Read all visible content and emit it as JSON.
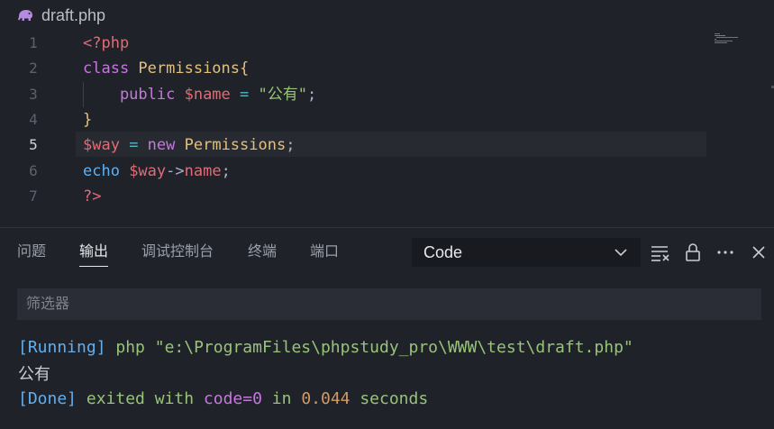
{
  "tab": {
    "file_icon": "php-elephant-icon",
    "file_name": "draft.php"
  },
  "editor": {
    "active_line": 5,
    "lines": [
      {
        "number": "1",
        "tokens": [
          {
            "t": "<?php",
            "c": "tag"
          }
        ]
      },
      {
        "number": "2",
        "tokens": [
          {
            "t": "class ",
            "c": "kw"
          },
          {
            "t": "Permissions{",
            "c": "cls"
          }
        ]
      },
      {
        "number": "3",
        "tokens": [
          {
            "t": "    public ",
            "c": "kw"
          },
          {
            "t": "$name",
            "c": "var"
          },
          {
            "t": " = ",
            "c": "op"
          },
          {
            "t": "\"公有\"",
            "c": "str"
          },
          {
            "t": ";",
            "c": "punc"
          }
        ]
      },
      {
        "number": "4",
        "tokens": [
          {
            "t": "}",
            "c": "cls"
          }
        ]
      },
      {
        "number": "5",
        "tokens": [
          {
            "t": "$way",
            "c": "var"
          },
          {
            "t": " = ",
            "c": "op"
          },
          {
            "t": "new ",
            "c": "kw"
          },
          {
            "t": "Permissions",
            "c": "cls"
          },
          {
            "t": ";",
            "c": "punc"
          }
        ]
      },
      {
        "number": "6",
        "tokens": [
          {
            "t": "echo ",
            "c": "echo"
          },
          {
            "t": "$way",
            "c": "var"
          },
          {
            "t": "->",
            "c": "punc"
          },
          {
            "t": "name",
            "c": "var"
          },
          {
            "t": ";",
            "c": "punc"
          }
        ]
      },
      {
        "number": "7",
        "tokens": [
          {
            "t": "?>",
            "c": "tag"
          }
        ]
      }
    ]
  },
  "panel": {
    "tabs": [
      {
        "label": "问题",
        "active": false
      },
      {
        "label": "输出",
        "active": true
      },
      {
        "label": "调试控制台",
        "active": false
      },
      {
        "label": "终端",
        "active": false
      },
      {
        "label": "端口",
        "active": false
      }
    ],
    "channel_selected": "Code",
    "actions": [
      "clear-output-icon",
      "lock-icon",
      "more-icon",
      "close-icon"
    ],
    "filter_placeholder": "筛选器"
  },
  "output": {
    "running_tag": "[Running]",
    "running_cmd": " php \"e:\\ProgramFiles\\phpstudy_pro\\WWW\\test\\draft.php\"",
    "result": "公有",
    "done_tag": "[Done]",
    "done_a": " exited with ",
    "done_code": "code=0",
    "done_b": " in ",
    "done_time": "0.044",
    "done_c": " seconds"
  },
  "colors": {
    "background": "#1f2229",
    "keyword": "#c678dd",
    "class": "#e5c07b",
    "variable": "#e06c75",
    "string": "#98c379",
    "function": "#61afef",
    "operator": "#56b6c2"
  }
}
